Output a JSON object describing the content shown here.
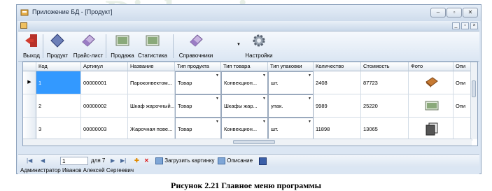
{
  "window": {
    "title": "Приложение БД - [Продукт]"
  },
  "toolbar": {
    "exit": "Выход",
    "product": "Продукт",
    "pricelist": "Прайс-лист",
    "sale": "Продажа",
    "stats": "Статистика",
    "refs": "Справочники",
    "settings": "Настройки"
  },
  "grid": {
    "columns": [
      "Код",
      "Артикул",
      "Название",
      "Тип продукта",
      "Тип товара",
      "Тип упаковки",
      "Количество",
      "Стоимость",
      "Фото",
      "Опи"
    ],
    "rows": [
      {
        "code": "1",
        "article": "00000001",
        "name": "Пароконвектом...",
        "ptype": "Товар",
        "gtype": "Конвекцион...",
        "pack": "шт.",
        "qty": "2408",
        "price": "87723",
        "photo": "book-photo",
        "desc": "Опи"
      },
      {
        "code": "2",
        "article": "00000002",
        "name": "Шкаф жарочный...",
        "ptype": "Товар",
        "gtype": "Шкафы жар...",
        "pack": "упак.",
        "qty": "9989",
        "price": "25220",
        "photo": "picture-photo",
        "desc": "Опи"
      },
      {
        "code": "3",
        "article": "00000003",
        "name": "Жарочная пове...",
        "ptype": "Товар",
        "gtype": "Конвекцион...",
        "pack": "шт.",
        "qty": "11898",
        "price": "13065",
        "photo": "pages-photo",
        "desc": ""
      }
    ]
  },
  "nav": {
    "position": "1",
    "of_total": "для 7",
    "load_image": "Загрузить картинку",
    "description": "Описание"
  },
  "status": {
    "text": "Администратор  Иванов Алексей Сергеевич"
  },
  "caption": "Рисунок 2.21 Главное меню программы",
  "watermark": "Diplom-it.ru"
}
